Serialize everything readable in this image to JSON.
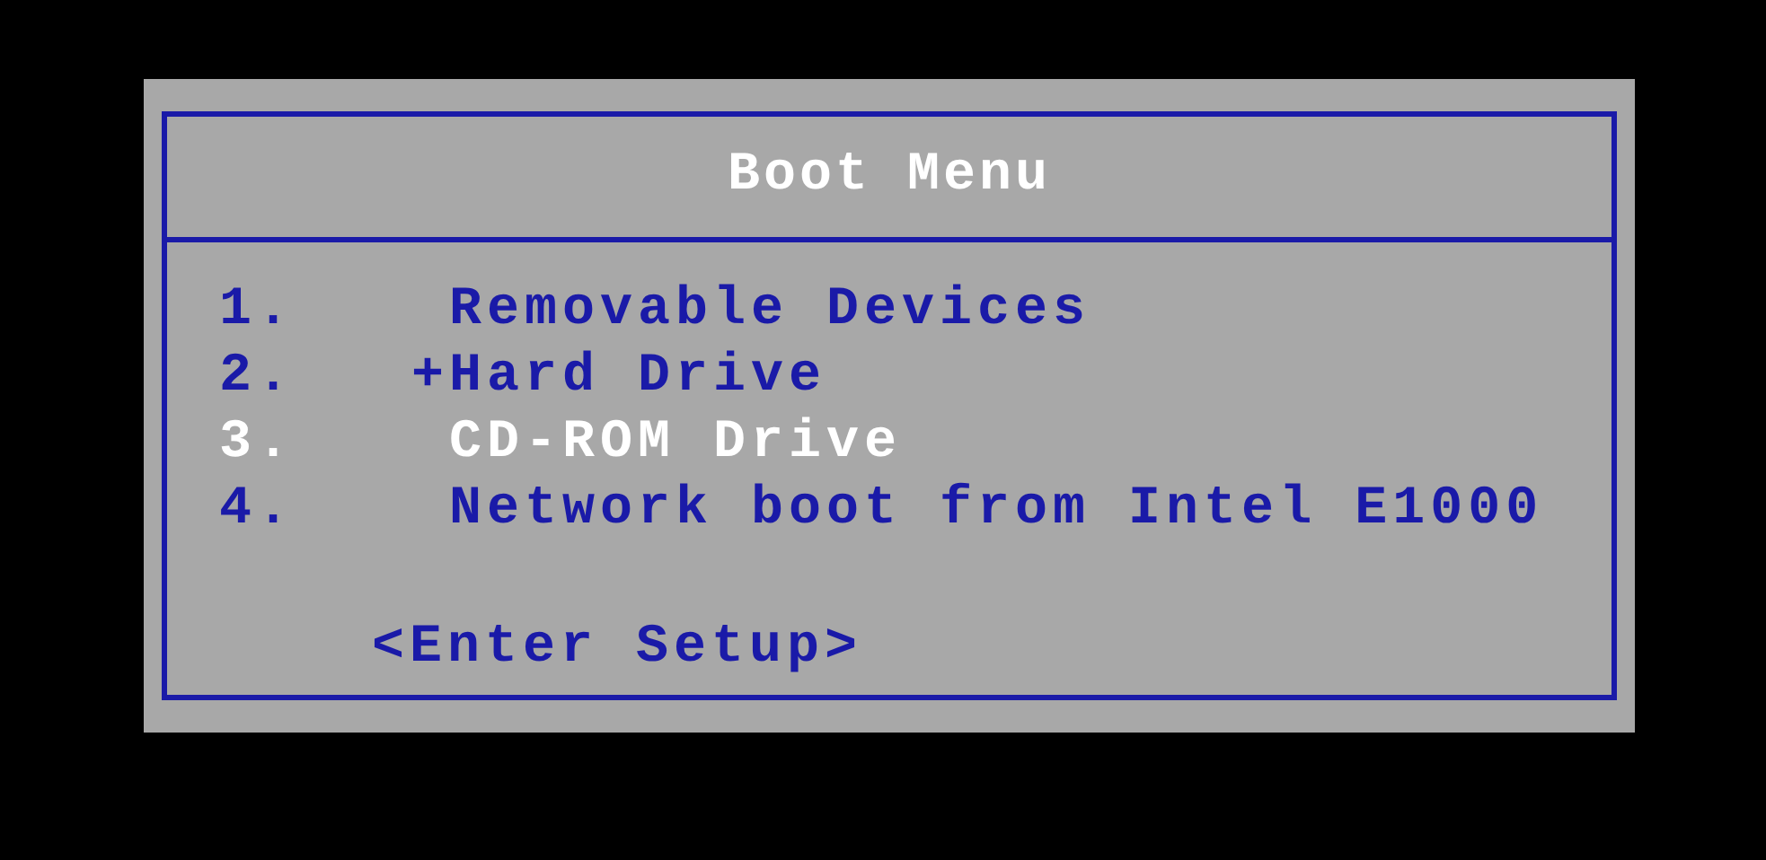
{
  "menu": {
    "title": "Boot Menu",
    "items": [
      {
        "number": "1.",
        "label": "Removable Devices",
        "selected": false
      },
      {
        "number": "2.",
        "prefix": "+",
        "label": "Hard Drive",
        "selected": false
      },
      {
        "number": "3.",
        "label": "CD-ROM Drive",
        "selected": true
      },
      {
        "number": "4.",
        "label": "Network boot from Intel E1000",
        "selected": false
      }
    ],
    "setup": "<Enter Setup>"
  }
}
